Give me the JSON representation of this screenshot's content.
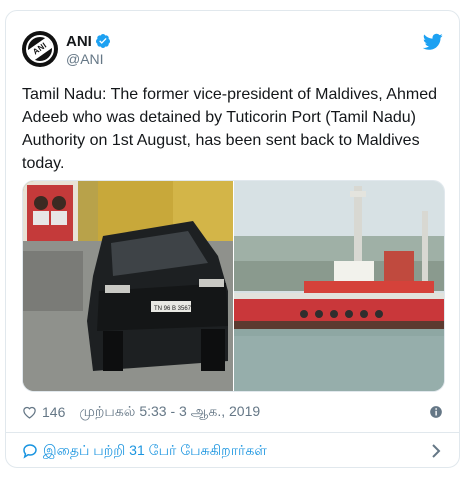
{
  "tweet": {
    "author": {
      "name": "ANI",
      "handle": "@ANI",
      "avatar_logo": "ANI",
      "verified_icon": "verified-badge-icon"
    },
    "platform_icon": "twitter-bird-icon",
    "text": "Tamil Nadu: The former vice-president of Maldives, Ahmed Adeeb who was detained by Tuticorin Port (Tamil Nadu) Authority on 1st August, has been sent back to Maldives today.",
    "media": {
      "left_image": "black-suv-at-port-photo",
      "right_image": "red-tugboat-at-port-photo",
      "plate_text": "TN 96 B 3567"
    },
    "likes": "146",
    "timestamp": "முற்பகல் 5:33 - 3 ஆக., 2019",
    "info_icon": "info-icon",
    "footer": {
      "text": "இதைப் பற்றி 31 பேர் பேசுகிறார்கள்",
      "icon": "speech-bubble-icon",
      "chevron": "chevron-right-icon"
    }
  },
  "colors": {
    "link_blue": "#1b95e0",
    "muted_gray": "#657786",
    "border": "#e1e8ed",
    "text": "#14171a"
  }
}
